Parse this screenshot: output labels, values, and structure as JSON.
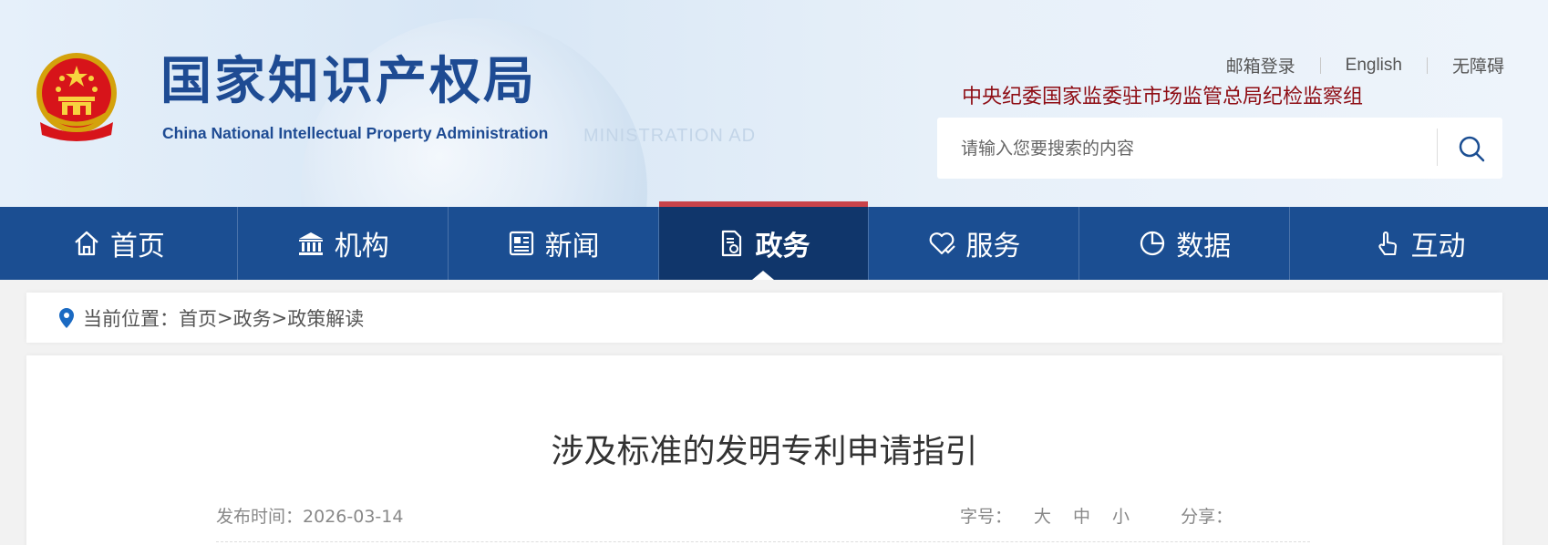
{
  "header": {
    "logo_cn": "国家知识产权局",
    "logo_en": "China National Intellectual Property Administration",
    "bg_ghost_text": "MINISTRATION AD",
    "top_links": [
      "邮箱登录",
      "English",
      "无障碍"
    ],
    "discipline_text": "中央纪委国家监委驻市场监管总局纪检监察组",
    "search": {
      "placeholder": "请输入您要搜索的内容"
    }
  },
  "nav": {
    "items": [
      {
        "label": "首页",
        "icon": "home-icon"
      },
      {
        "label": "机构",
        "icon": "institution-icon"
      },
      {
        "label": "新闻",
        "icon": "news-icon"
      },
      {
        "label": "政务",
        "icon": "government-doc-icon",
        "active": true
      },
      {
        "label": "服务",
        "icon": "service-heart-icon"
      },
      {
        "label": "数据",
        "icon": "pie-chart-icon"
      },
      {
        "label": "互动",
        "icon": "hand-pointer-icon"
      }
    ]
  },
  "breadcrumb": {
    "prefix": "当前位置：",
    "items": [
      "首页",
      "政务",
      "政策解读"
    ],
    "separator": ">"
  },
  "article": {
    "title": "涉及标准的发明专利申请指引",
    "date_label": "发布时间：",
    "date_value": "2026-03-14",
    "font_size_label": "字号：",
    "font_sizes": [
      "大",
      "中",
      "小"
    ],
    "share_label": "分享："
  },
  "colors": {
    "nav_bg": "#1b4e92",
    "nav_active": "#10366b",
    "nav_active_bar": "#c8434a",
    "logo_blue": "#1e4b93",
    "discipline_red": "#8e0d14"
  }
}
